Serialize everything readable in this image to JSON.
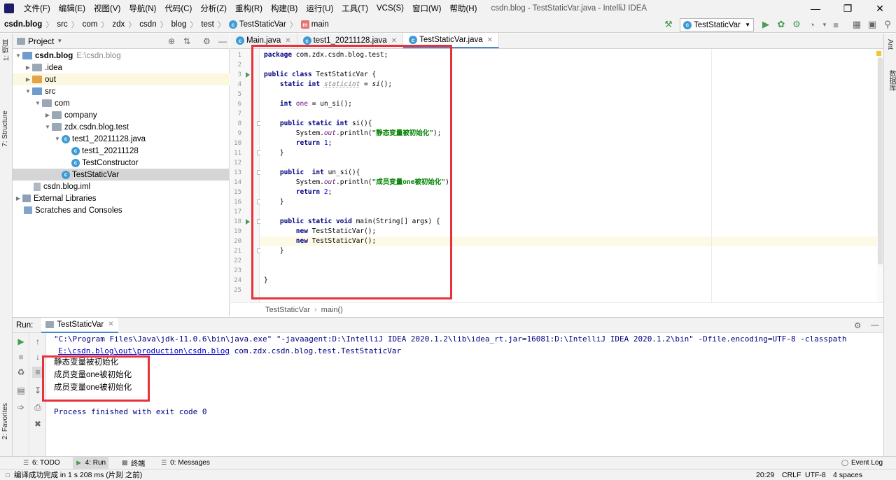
{
  "menu": {
    "items": [
      "文件(F)",
      "编辑(E)",
      "视图(V)",
      "导航(N)",
      "代码(C)",
      "分析(Z)",
      "重构(R)",
      "构建(B)",
      "运行(U)",
      "工具(T)",
      "VCS(S)",
      "窗口(W)",
      "帮助(H)"
    ],
    "window_title": "csdn.blog - TestStaticVar.java - IntelliJ IDEA"
  },
  "breadcrumb": {
    "project": "csdn.blog",
    "parts": [
      "src",
      "com",
      "zdx",
      "csdn",
      "blog",
      "test"
    ],
    "class": "TestStaticVar",
    "method": "main"
  },
  "toolbar": {
    "run_config": "TestStaticVar"
  },
  "left_strip": {
    "project_tab": "1: 项目",
    "structure_tab": "7: Structure",
    "favorites_tab": "2: Favorites"
  },
  "right_strip": {
    "ant_tab": "Ant",
    "db_tab": "数据库"
  },
  "project_panel": {
    "title": "Project",
    "tree": [
      {
        "label": "csdn.blog",
        "extra": "E:\\csdn.blog",
        "type": "module",
        "expanded": true
      },
      {
        "label": ".idea",
        "type": "folder",
        "expanded": false
      },
      {
        "label": "out",
        "type": "folder-orange",
        "expanded": false
      },
      {
        "label": "src",
        "type": "folder-blue",
        "expanded": true
      },
      {
        "label": "com",
        "type": "package",
        "expanded": true
      },
      {
        "label": "company",
        "type": "package",
        "expanded": false
      },
      {
        "label": "zdx.csdn.blog.test",
        "type": "package",
        "expanded": true
      },
      {
        "label": "test1_20211128.java",
        "type": "javafile",
        "expanded": true
      },
      {
        "label": "test1_20211128",
        "type": "class"
      },
      {
        "label": "TestConstructor",
        "type": "class"
      },
      {
        "label": "TestStaticVar",
        "type": "class"
      },
      {
        "label": "csdn.blog.iml",
        "type": "iml"
      },
      {
        "label": "External Libraries",
        "type": "lib",
        "expanded": false
      },
      {
        "label": "Scratches and Consoles",
        "type": "scratch"
      }
    ]
  },
  "editor": {
    "tabs": [
      {
        "label": "Main.java",
        "active": false
      },
      {
        "label": "test1_20211128.java",
        "active": false
      },
      {
        "label": "TestStaticVar.java",
        "active": true
      }
    ],
    "line_numbers": [
      "1",
      "2",
      "3",
      "4",
      "5",
      "6",
      "7",
      "8",
      "9",
      "10",
      "11",
      "12",
      "13",
      "14",
      "15",
      "16",
      "17",
      "18",
      "19",
      "20",
      "21",
      "22",
      "23",
      "24",
      "25"
    ],
    "code": {
      "l1_kw": "package",
      "l1_rest": " com.zdx.csdn.blog.test;",
      "l3_kw": "public class",
      "l3_rest": " TestStaticVar {",
      "l4_kw": "static int",
      "l4_field": "staticint",
      "l4_eq": " = ",
      "l4_call": "si",
      "l4_end": "();",
      "l6_kw": "int",
      "l6_field": "one",
      "l6_rest": " = un_si();",
      "l8_kw": "public static int",
      "l8_rest": " si(){",
      "sys": "System.",
      "out": "out",
      "println": ".println(",
      "l9_str": "\"静态变量被初始化\"",
      "close_call": ");",
      "ret": "return",
      "l10_num": "1",
      "semi": ";",
      "rbrace": "}",
      "l13_kw": "public",
      "l13_kw2": "int",
      "l13_rest": " un_si(){",
      "l14_str": "\"成员变量one被初始化\"",
      "l15_num": "2",
      "l18_kw": "public static void",
      "l18_rest": " main(String[] args) {",
      "new_kw": "new",
      "new_rest": " TestStaticVar();"
    },
    "crumb_class": "TestStaticVar",
    "crumb_method": "main()"
  },
  "run_panel": {
    "label": "Run:",
    "tab": "TestStaticVar",
    "cmd_line1": "\"C:\\Program Files\\Java\\jdk-11.0.6\\bin\\java.exe\" \"-javaagent:D:\\IntelliJ IDEA 2020.1.2\\lib\\idea_rt.jar=16081:D:\\IntelliJ IDEA 2020.1.2\\bin\" -Dfile.encoding=UTF-8 -classpath",
    "cmd_link": "E:\\csdn.blog\\out\\production\\csdn.blog",
    "cmd_line2_rest": " com.zdx.csdn.blog.test.TestStaticVar",
    "output": [
      "静态变量被初始化",
      "成员变量one被初始化",
      "成员变量one被初始化"
    ],
    "finish": "Process finished with exit code 0"
  },
  "bottom_tabs": [
    {
      "label": "6: TODO",
      "active": false
    },
    {
      "label": "4: Run",
      "active": true
    },
    {
      "label": "终端",
      "active": false
    },
    {
      "label": "0: Messages",
      "active": false
    }
  ],
  "event_log": "Event Log",
  "status": {
    "message": "编译成功完成 in 1 s 208 ms (片刻 之前)",
    "position": "20:29",
    "line_sep": "CRLF",
    "encoding": "UTF-8",
    "indent": "4 spaces"
  },
  "colors": {
    "highlight_box": "#e8313a",
    "keyword": "#000080",
    "string": "#008000",
    "number": "#0000ff",
    "field": "#660e7a",
    "run_green": "#499c54"
  }
}
